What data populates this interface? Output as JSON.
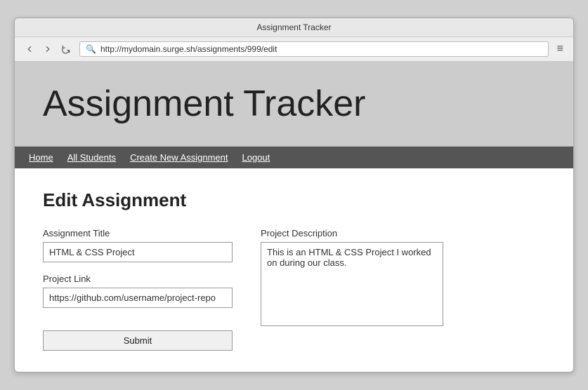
{
  "titleBar": {
    "title": "Assignment Tracker"
  },
  "browserToolbar": {
    "addressBar": {
      "url": "http://mydomain.surge.sh/assignments/999/edit",
      "placeholder": "http://mydomain.surge.sh/assignments/999/edit"
    }
  },
  "pageHeader": {
    "title": "Assignment Tracker"
  },
  "navBar": {
    "items": [
      {
        "label": "Home",
        "href": "#"
      },
      {
        "label": "All Students",
        "href": "#"
      },
      {
        "label": "Create New Assignment",
        "href": "#"
      },
      {
        "label": "Logout",
        "href": "#"
      }
    ]
  },
  "mainContent": {
    "pageTitle": "Edit Assignment",
    "form": {
      "assignmentTitleLabel": "Assignment Title",
      "assignmentTitleValue": "HTML & CSS Project",
      "projectLinkLabel": "Project Link",
      "projectLinkValue": "https://github.com/username/project-repo",
      "projectDescriptionLabel": "Project Description",
      "projectDescriptionValue": "This is an HTML & CSS Project I worked on during our class.",
      "submitLabel": "Submit"
    }
  }
}
